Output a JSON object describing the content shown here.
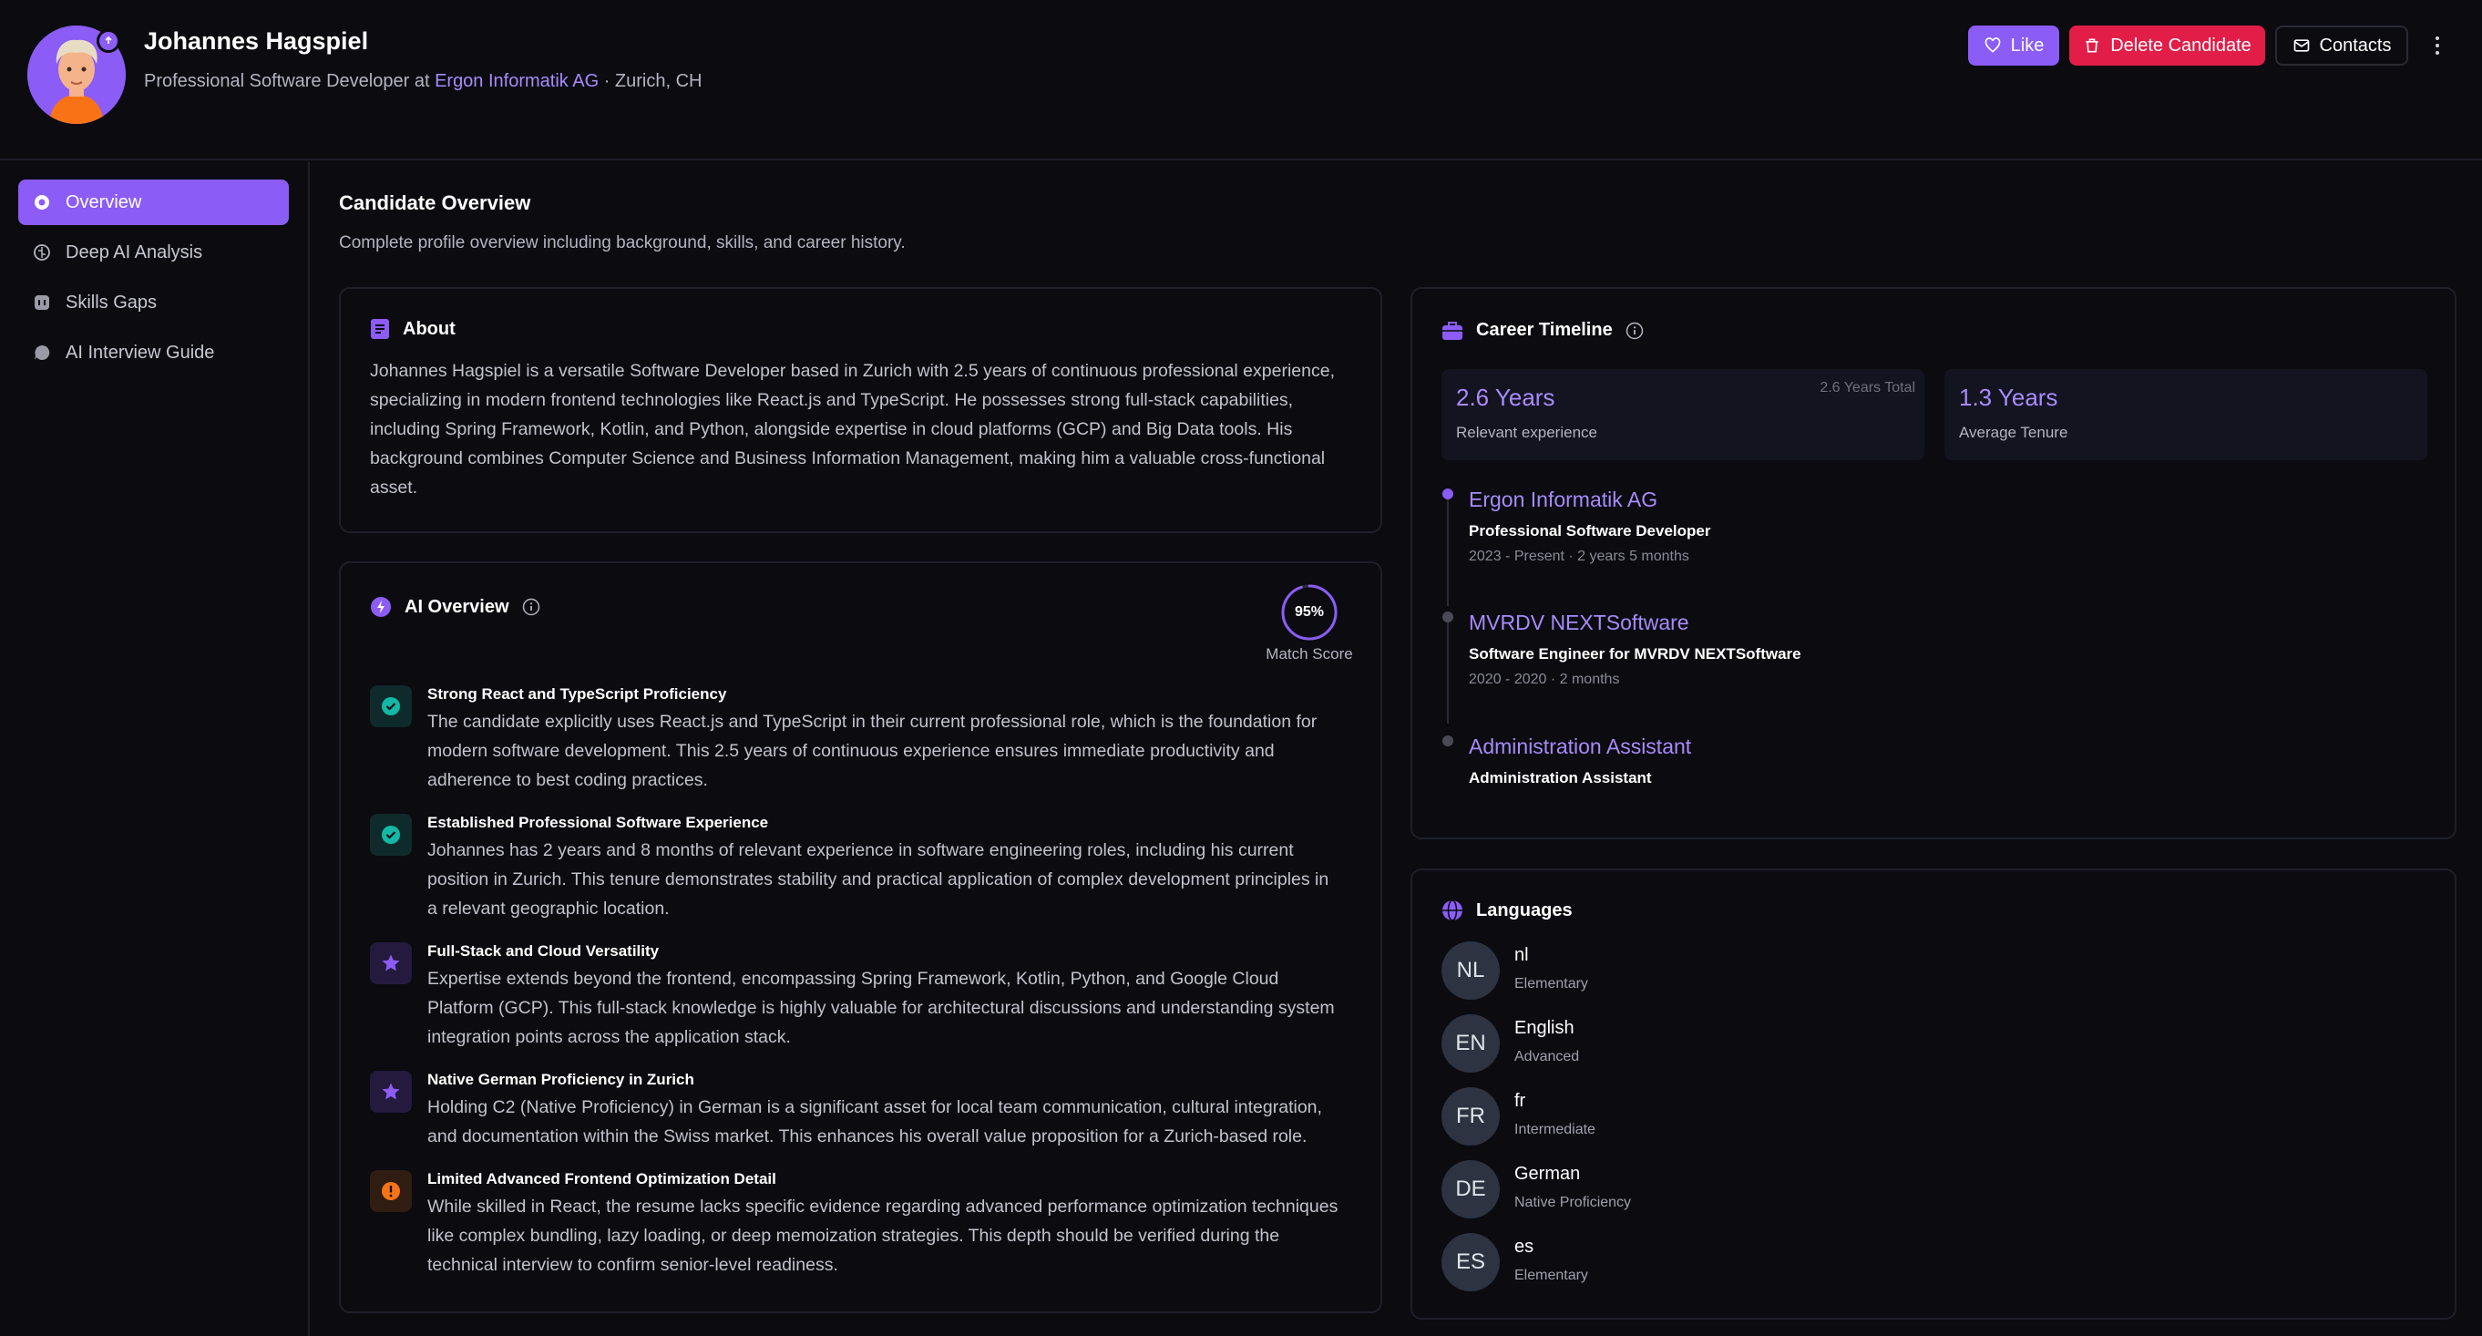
{
  "header": {
    "name": "Johannes Hagspiel",
    "role_prefix": "Professional Software Developer at ",
    "company": "Ergon Informatik AG",
    "location": " · Zurich, CH",
    "like_label": "Like",
    "delete_label": "Delete Candidate",
    "contacts_label": "Contacts"
  },
  "sidebar": {
    "items": [
      {
        "label": "Overview",
        "icon": "eye-icon"
      },
      {
        "label": "Deep AI Analysis",
        "icon": "brain-icon"
      },
      {
        "label": "Skills Gaps",
        "icon": "gap-icon"
      },
      {
        "label": "AI Interview Guide",
        "icon": "chat-icon"
      }
    ]
  },
  "main": {
    "title": "Candidate Overview",
    "subtitle": "Complete profile overview including background, skills, and career history."
  },
  "about": {
    "title": "About",
    "text": "Johannes Hagspiel is a versatile Software Developer based in Zurich with 2.5 years of continuous professional experience, specializing in modern frontend technologies like React.js and TypeScript. He possesses strong full-stack capabilities, including Spring Framework, Kotlin, and Python, alongside expertise in cloud platforms (GCP) and Big Data tools. His background combines Computer Science and Business Information Management, making him a valuable cross-functional asset."
  },
  "ai_overview": {
    "title": "AI Overview",
    "match_score": "95%",
    "match_label": "Match Score",
    "match_value": 0.95,
    "insights": [
      {
        "type": "check",
        "title": "Strong React and TypeScript Proficiency",
        "text": "The candidate explicitly uses React.js and TypeScript in their current professional role, which is the foundation for modern software development. This 2.5 years of continuous experience ensures immediate productivity and adherence to best coding practices."
      },
      {
        "type": "check",
        "title": "Established Professional Software Experience",
        "text": "Johannes has 2 years and 8 months of relevant experience in software engineering roles, including his current position in Zurich. This tenure demonstrates stability and practical application of complex development principles in a relevant geographic location."
      },
      {
        "type": "star",
        "title": "Full-Stack and Cloud Versatility",
        "text": "Expertise extends beyond the frontend, encompassing Spring Framework, Kotlin, Python, and Google Cloud Platform (GCP). This full-stack knowledge is highly valuable for architectural discussions and understanding system integration points across the application stack."
      },
      {
        "type": "star",
        "title": "Native German Proficiency in Zurich",
        "text": "Holding C2 (Native Proficiency) in German is a significant asset for local team communication, cultural integration, and documentation within the Swiss market. This enhances his overall value proposition for a Zurich-based role."
      },
      {
        "type": "warning",
        "title": "Limited Advanced Frontend Optimization Detail",
        "text": "While skilled in React, the resume lacks specific evidence regarding advanced performance optimization techniques like complex bundling, lazy loading, or deep memoization strategies. This depth should be verified during the technical interview to confirm senior-level readiness."
      }
    ]
  },
  "career": {
    "title": "Career Timeline",
    "relevant_value": "2.6 Years",
    "relevant_label": "Relevant experience",
    "total_note": "2.6 Years Total",
    "tenure_value": "1.3 Years",
    "tenure_label": "Average Tenure",
    "jobs": [
      {
        "company": "Ergon Informatik AG",
        "role": "Professional Software Developer",
        "dates": "2023 - Present · 2 years 5 months"
      },
      {
        "company": "MVRDV NEXTSoftware",
        "role": "Software Engineer for MVRDV NEXTSoftware",
        "dates": "2020 - 2020 · 2 months"
      },
      {
        "company": "Administration Assistant",
        "role": "Administration Assistant",
        "dates": ""
      }
    ]
  },
  "languages": {
    "title": "Languages",
    "items": [
      {
        "code": "NL",
        "name": "nl",
        "level": "Elementary"
      },
      {
        "code": "EN",
        "name": "English",
        "level": "Advanced"
      },
      {
        "code": "FR",
        "name": "fr",
        "level": "Intermediate"
      },
      {
        "code": "DE",
        "name": "German",
        "level": "Native Proficiency"
      },
      {
        "code": "ES",
        "name": "es",
        "level": "Elementary"
      }
    ]
  },
  "colors": {
    "accent": "#8b5cf6",
    "accent_light": "#a78bfa",
    "danger": "#e11d48",
    "success": "#14b8a6",
    "warning": "#f97316",
    "background": "#0b0b10"
  }
}
